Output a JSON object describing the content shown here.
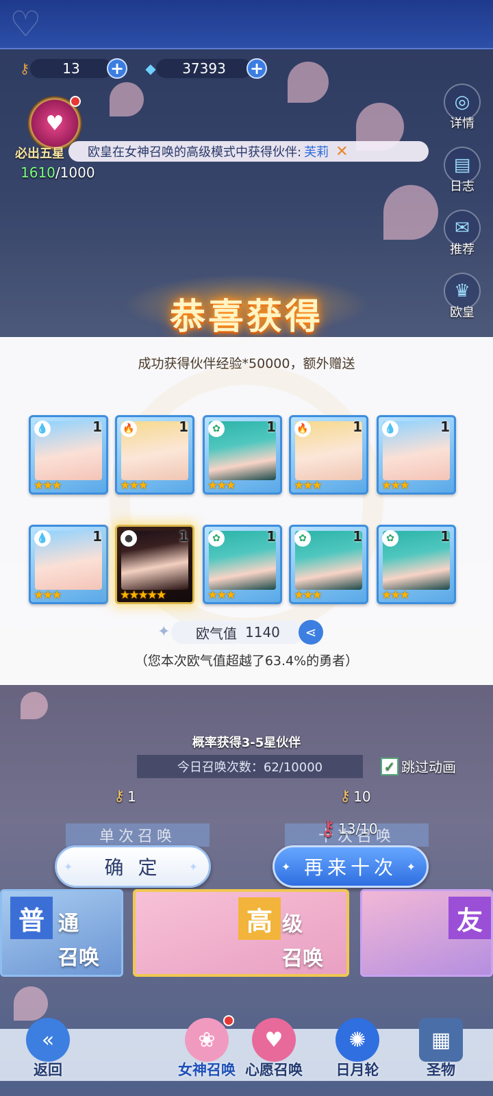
{
  "currencies": [
    {
      "icon": "summon-key-icon",
      "value": "13"
    },
    {
      "icon": "gem-icon",
      "value": "37393"
    }
  ],
  "guarantee": {
    "label": "必出五星",
    "current": "1610",
    "total": "/1000"
  },
  "ticker": {
    "text": "欧皇在女神召唤的高级模式中获得伙伴:",
    "name": "芙莉"
  },
  "side_menu": [
    "详情",
    "日志",
    "推荐",
    "欧皇"
  ],
  "result": {
    "title": "恭喜获得",
    "exp_text": "成功获得伙伴经验*50000，额外赠送",
    "cards": [
      {
        "element": "water",
        "level": "1",
        "stars": "★★★",
        "portrait": "blue"
      },
      {
        "element": "fire",
        "level": "1",
        "stars": "★★★",
        "portrait": "blonde"
      },
      {
        "element": "wind",
        "level": "1",
        "stars": "★★★",
        "portrait": "teal"
      },
      {
        "element": "fire",
        "level": "1",
        "stars": "★★★",
        "portrait": "blonde"
      },
      {
        "element": "water",
        "level": "1",
        "stars": "★★★",
        "portrait": "blue"
      },
      {
        "element": "water",
        "level": "1",
        "stars": "★★★",
        "portrait": "blue"
      },
      {
        "element": "dark",
        "level": "1",
        "stars": "★★★★★",
        "portrait": "dark"
      },
      {
        "element": "wind",
        "level": "1",
        "stars": "★★★",
        "portrait": "teal"
      },
      {
        "element": "wind",
        "level": "1",
        "stars": "★★★",
        "portrait": "teal"
      },
      {
        "element": "wind",
        "level": "1",
        "stars": "★★★",
        "portrait": "teal"
      }
    ],
    "luck_label": "欧气值",
    "luck_value": "1140",
    "luck_desc": "（您本次欧气值超越了63.4%的勇者）"
  },
  "summon": {
    "prob_text": "概率获得3-5星伙伴",
    "daily_text": "今日召唤次数：62/10000",
    "skip_label": "跳过动画",
    "single_cost": "1",
    "ten_cost": "10",
    "ten_have": "13/10",
    "single_label": "单次召唤",
    "ten_label": "十次召唤",
    "confirm_label": "确 定",
    "again_label": "再来十次"
  },
  "banners": {
    "normal": {
      "badge": "普",
      "l1": "通",
      "l2": "召唤"
    },
    "high": {
      "badge": "高",
      "l1": "级",
      "l2": "召唤"
    },
    "friend": {
      "badge": "友"
    }
  },
  "nav": [
    "返回",
    "女神召唤",
    "心愿召唤",
    "日月轮",
    "圣物"
  ]
}
